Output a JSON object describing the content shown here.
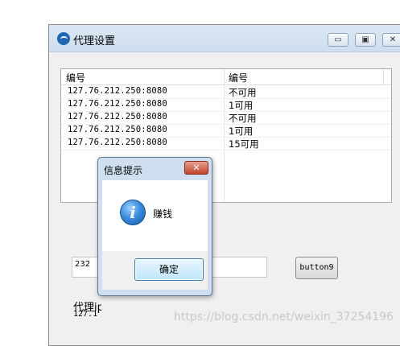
{
  "window": {
    "title": "代理设置",
    "minimize_symbol": "▭",
    "maximize_symbol": "▣",
    "close_symbol": "✕"
  },
  "listview": {
    "columns": [
      "编号",
      "编号"
    ],
    "rows": [
      [
        "127.76.212.250:8080",
        "不可用"
      ],
      [
        "127.76.212.250:8080",
        "1可用"
      ],
      [
        "127.76.212.250:8080",
        "不可用"
      ],
      [
        "127.76.212.250:8080",
        "1可用"
      ],
      [
        "127.76.212.250:8080",
        "15可用"
      ]
    ]
  },
  "textbox": {
    "value": "232"
  },
  "button9": {
    "label": "button9"
  },
  "labels": {
    "proxy_label": "代理ip",
    "proxy_value": "127.1"
  },
  "dialog": {
    "title": "信息提示",
    "close_symbol": "✕",
    "icon": "info-icon",
    "icon_glyph": "i",
    "message": "赚钱",
    "ok_label": "确定"
  },
  "watermark": "https://blog.csdn.net/weixin_37254196"
}
